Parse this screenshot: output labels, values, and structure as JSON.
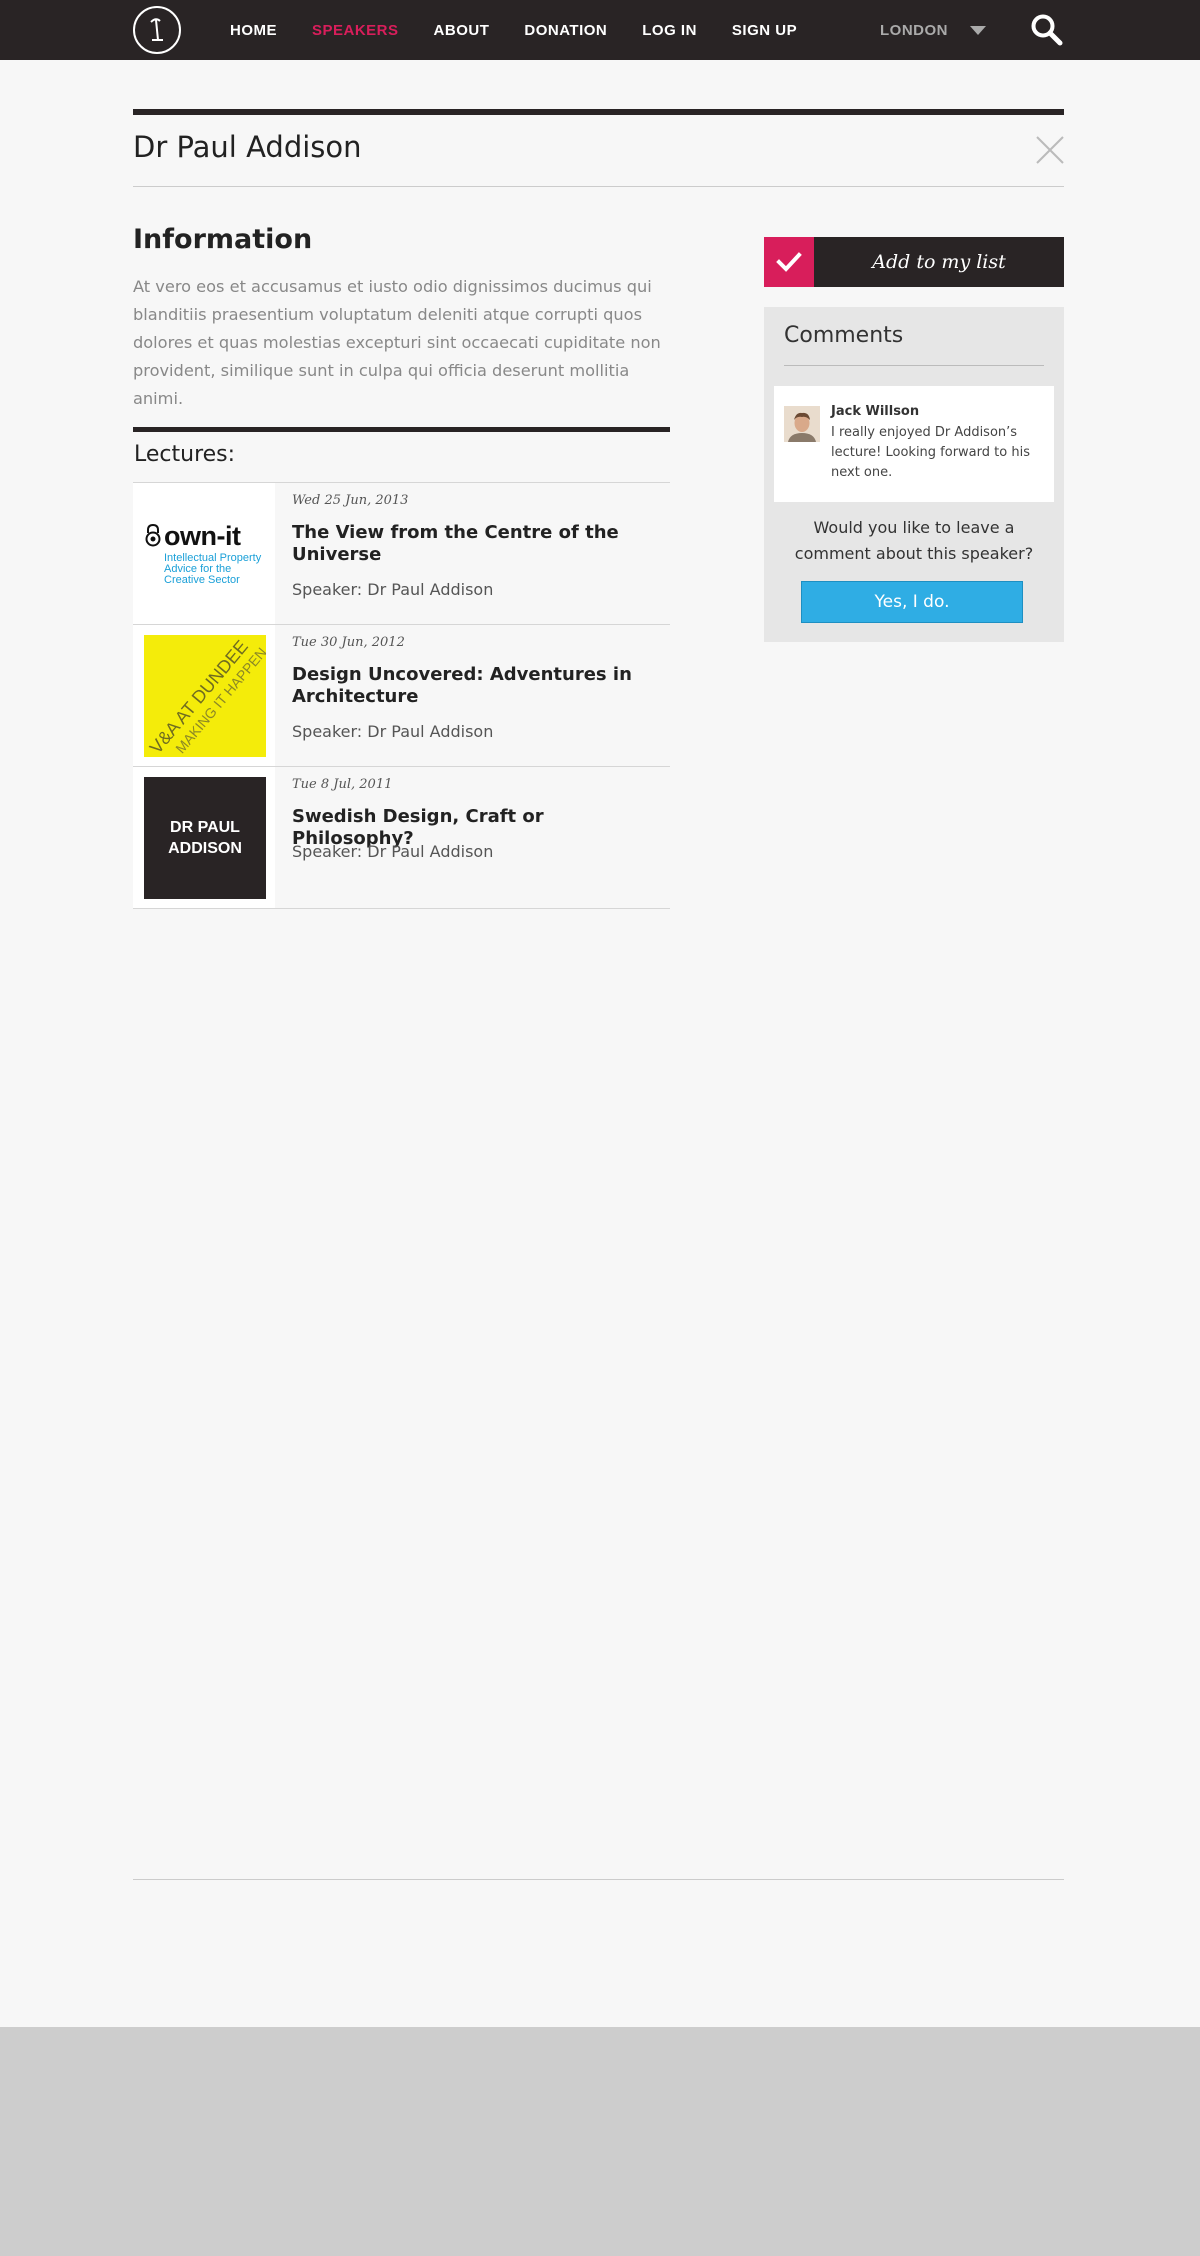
{
  "nav": {
    "items": [
      {
        "label": "HOME",
        "active": false
      },
      {
        "label": "SPEAKERS",
        "active": true
      },
      {
        "label": "ABOUT",
        "active": false
      },
      {
        "label": "DONATION",
        "active": false
      },
      {
        "label": "LOG IN",
        "active": false
      },
      {
        "label": "SIGN UP",
        "active": false
      }
    ],
    "city": "LONDON",
    "icons": {
      "logo": "lamp-logo-icon",
      "search": "search-icon",
      "city_caret": "caret-down-icon"
    }
  },
  "speaker": {
    "name": "Dr Paul Addison",
    "close_icon": "close-icon"
  },
  "information": {
    "heading": "Information",
    "text": "At vero eos et accusamus et iusto odio dignissimos ducimus qui blanditiis praesentium voluptatum deleniti atque corrupti quos dolores et quas molestias excepturi sint occaecati cupiditate non provident, similique sunt in culpa qui officia deserunt mollitia animi."
  },
  "lectures": {
    "heading": "Lectures:",
    "items": [
      {
        "date": "Wed 25 Jun, 2013",
        "title": "The View from the Centre of the Universe",
        "speaker": "Speaker: Dr Paul Addison",
        "thumb": {
          "word": "own-it",
          "sub": "Intellectual Property Advice for the Creative Sector"
        }
      },
      {
        "date": "Tue 30 Jun, 2012",
        "title": "Design Uncovered: Adventures in Architecture",
        "speaker": "Speaker: Dr Paul Addison",
        "thumb": {
          "line1": "V&A AT DUNDEE",
          "line2": "MAKING IT HAPPEN"
        }
      },
      {
        "date": "Tue 8 Jul, 2011",
        "title": "Swedish Design, Craft or Philosophy?",
        "speaker": "Speaker: Dr Paul Addison",
        "thumb": {
          "text": "DR PAUL ADDISON"
        }
      }
    ]
  },
  "sidebar": {
    "add_label": "Add to my list",
    "comments_heading": "Comments",
    "comment": {
      "name": "Jack Willson",
      "text": "I really enjoyed Dr Addison’s lecture!  Looking forward to his next one."
    },
    "prompt": "Would you like to leave a comment about this speaker?",
    "yes_label": "Yes, I do."
  },
  "colors": {
    "accent": "#d81e5b",
    "dark": "#292425",
    "button_blue": "#2fade4",
    "thumb_yellow": "#f4ec0a"
  }
}
